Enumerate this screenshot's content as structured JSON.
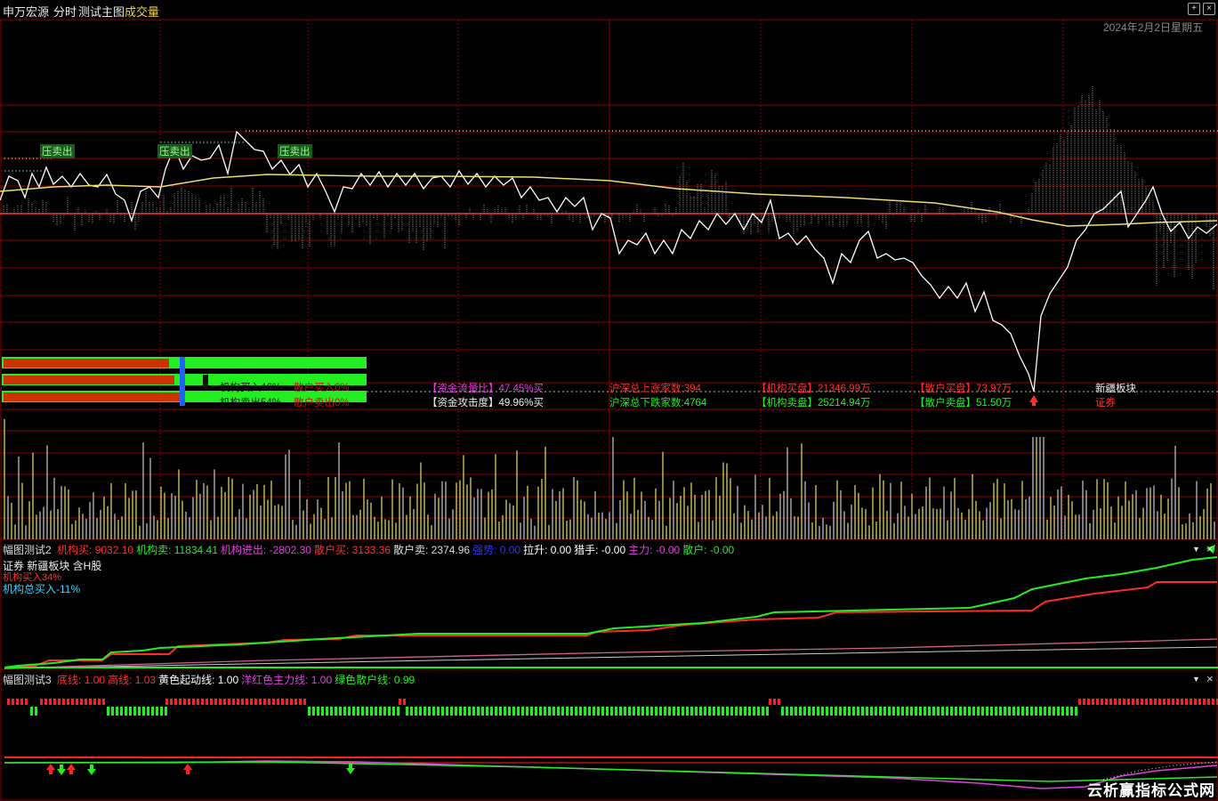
{
  "header": {
    "stock_name": "申万宏源",
    "period": "分时",
    "main_chart_name": "测试主图",
    "overlay_name": "成交量",
    "date": "2024年2月2日星期五"
  },
  "colors": {
    "grid_red": "#8b0000",
    "price_line": "#ffffff",
    "avg_line": "#e8e070",
    "buy_red": "#ff2a2a",
    "sell_green": "#22ee22",
    "magenta": "#e040e0",
    "cyan": "#40d0ff"
  },
  "signals": {
    "pressure_sell_label": "压卖出",
    "up_arrow": "up-arrow-icon",
    "down_arrow": "down-arrow-icon"
  },
  "panel_stats": {
    "inst_buy": "机构买入46%",
    "retail_buy": "散户买入0%",
    "inst_sell": "机构卖出54%",
    "retail_sell": "散户卖出0%",
    "inst_buy_pct": 46,
    "inst_sell_pct": 54
  },
  "info_row1": {
    "fund_flow": "【资金流量比】47.45%买",
    "sh_sz_up": "沪深总上涨家数:394",
    "inst_buy_disk": "【机构买盘】21346.99万",
    "retail_buy_disk": "【散户买盘】73.97万",
    "sector": "新疆板块"
  },
  "info_row2": {
    "fund_attack": "【资金攻击度】49.96%买",
    "sh_sz_down": "沪深总下跌家数:4764",
    "inst_sell_disk": "【机构卖盘】25214.94万",
    "retail_sell_disk": "【散户卖盘】51.50万",
    "industry": "证券"
  },
  "pane2": {
    "title": "幅图测试2",
    "items": [
      {
        "label": "机构买:",
        "value": "9032.10",
        "color": "#ff3030"
      },
      {
        "label": "机构卖:",
        "value": "11834.41",
        "color": "#22ee22"
      },
      {
        "label": "机构进出:",
        "value": "-2802.30",
        "color": "#e040e0"
      },
      {
        "label": "散户买:",
        "value": "3133.36",
        "color": "#ff3030"
      },
      {
        "label": "散户卖:",
        "value": "2374.96",
        "color": "#dddddd"
      },
      {
        "label": "强势:",
        "value": "0.00",
        "color": "#3030ff"
      },
      {
        "label": "拉升:",
        "value": "0.00",
        "color": "#ffffff"
      },
      {
        "label": "猎手:",
        "value": "-0.00",
        "color": "#ffffff"
      },
      {
        "label": "主力:",
        "value": "-0.00",
        "color": "#e040e0"
      },
      {
        "label": "散户:",
        "value": "-0.00",
        "color": "#22ee22"
      }
    ],
    "line1": "证券 新疆板块 含H股",
    "line2": "机构买入34%",
    "line3": "机构总买入-11%"
  },
  "pane3": {
    "title": "幅图测试3",
    "items": [
      {
        "label": "底线:",
        "value": "1.00",
        "color": "#ff3030"
      },
      {
        "label": "高线:",
        "value": "1.03",
        "color": "#ff3030"
      },
      {
        "label": "黄色起动线:",
        "value": "1.00",
        "color": "#ffffff"
      },
      {
        "label": "洋红色主力线:",
        "value": "1.00",
        "color": "#e040e0"
      },
      {
        "label": "绿色散户线:",
        "value": "0.99",
        "color": "#22ee22"
      }
    ]
  },
  "watermark": "云析赢指标公式网"
}
